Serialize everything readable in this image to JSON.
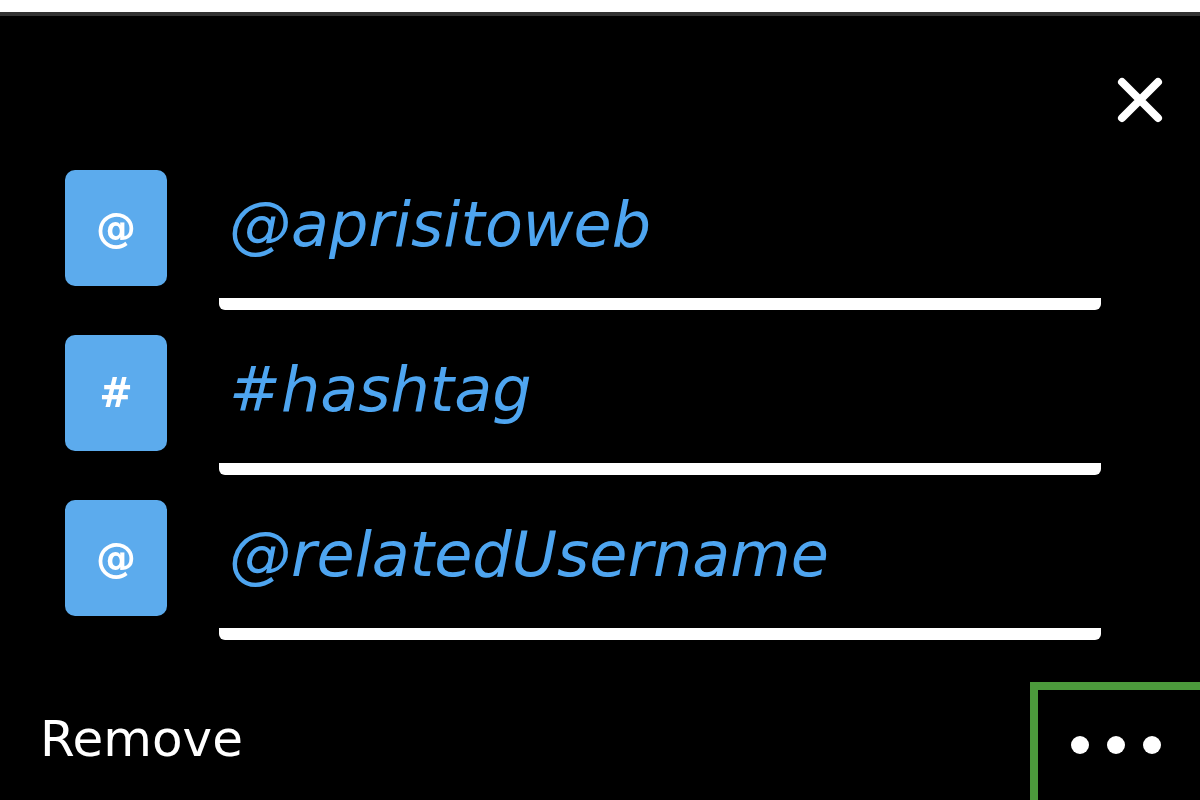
{
  "entries": [
    {
      "symbol": "@",
      "value": "@aprisitoweb"
    },
    {
      "symbol": "#",
      "value": "#hashtag"
    },
    {
      "symbol": "@",
      "value": "@relatedUsername"
    }
  ],
  "remove_label": "Remove"
}
